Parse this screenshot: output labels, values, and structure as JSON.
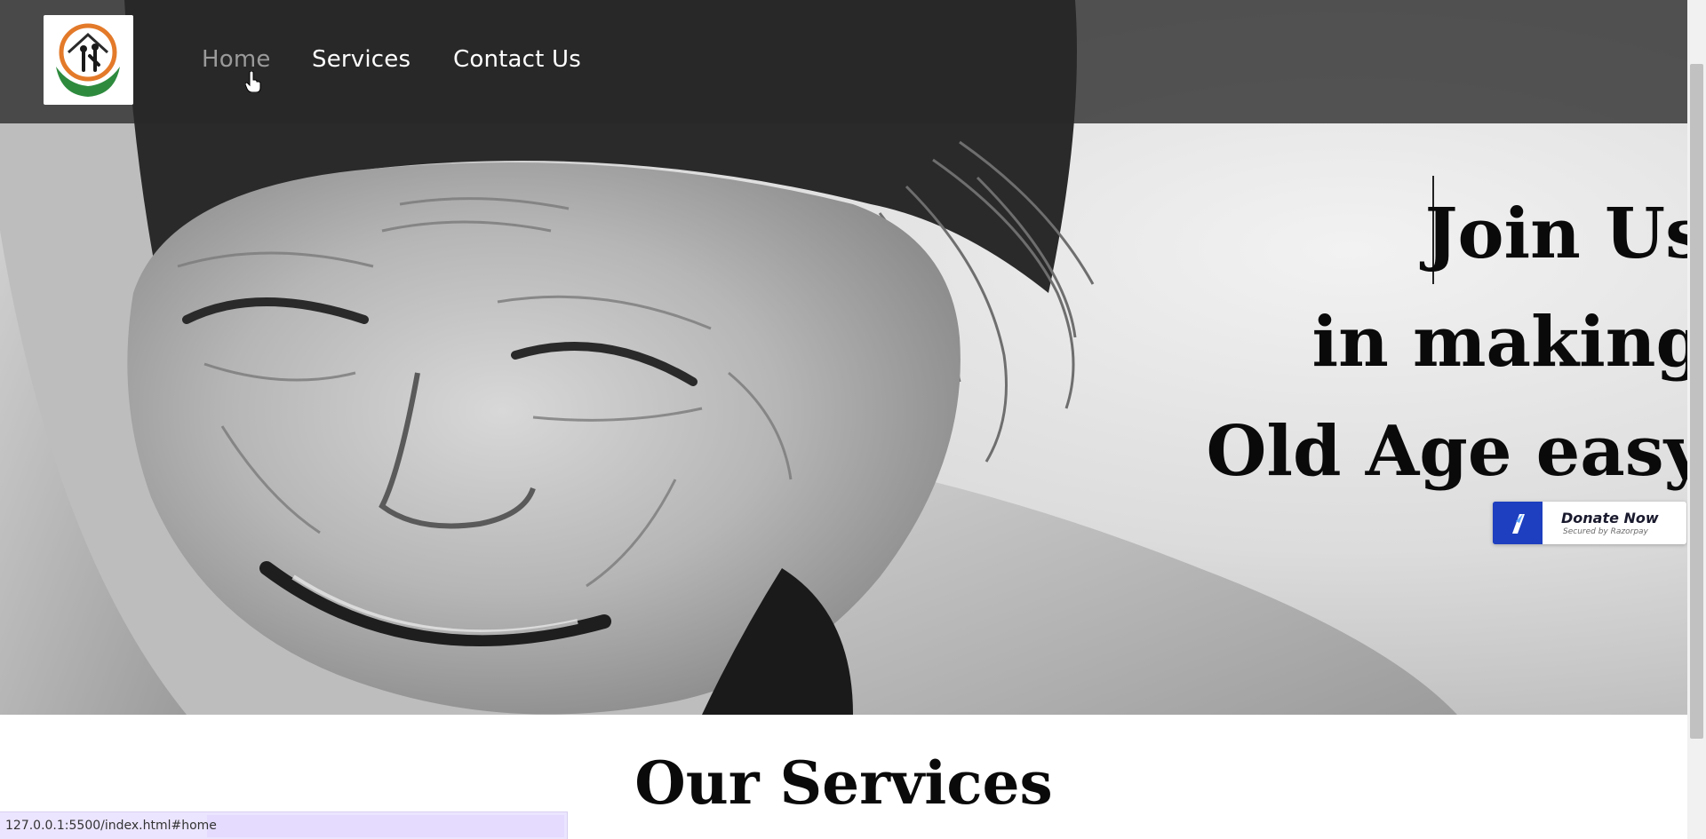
{
  "nav": {
    "logo_alt": "elderly-care-logo",
    "links": [
      {
        "label": "Home",
        "state": "active-hover"
      },
      {
        "label": "Services",
        "state": "normal"
      },
      {
        "label": "Contact Us",
        "state": "normal"
      }
    ]
  },
  "hero": {
    "lines": [
      "Join Us",
      "in making",
      "Old Age easy"
    ],
    "image": "elderly-woman-smiling-grayscale-photo"
  },
  "donate": {
    "label": "Donate Now",
    "subtitle": "Secured by Razorpay",
    "icon": "razorpay-icon",
    "brand_color": "#1e3fbf"
  },
  "services": {
    "heading": "Our Services"
  },
  "status_bar": {
    "url": "127.0.0.1:5500/index.html#home"
  },
  "colors": {
    "navbar_bg": "#282828",
    "nav_text": "#ffffff",
    "nav_active": "#9a9a9a",
    "heading": "#0a0a0a"
  }
}
